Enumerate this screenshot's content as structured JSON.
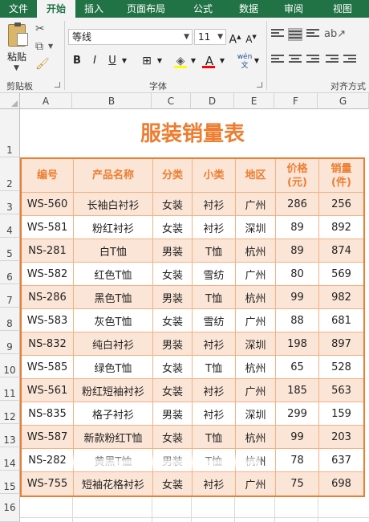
{
  "ribbon": {
    "tabs": [
      "文件",
      "开始",
      "插入",
      "页面布局",
      "公式",
      "数据",
      "审阅",
      "视图"
    ],
    "active_tab": "开始",
    "clipboard": {
      "paste_label": "粘贴",
      "group_label": "剪贴板"
    },
    "font": {
      "name": "等线",
      "size": "11",
      "bold": "B",
      "italic": "I",
      "underline": "U",
      "grow": "A",
      "shrink": "A",
      "group_label": "字体",
      "font_color": "A",
      "phonetic": "wén"
    },
    "alignment": {
      "group_label": "对齐方式"
    },
    "accent_color": "#217346"
  },
  "sheet": {
    "columns": [
      "A",
      "B",
      "C",
      "D",
      "E",
      "F",
      "G"
    ],
    "rows": [
      "1",
      "2",
      "3",
      "4",
      "5",
      "6",
      "7",
      "8",
      "9",
      "10",
      "11",
      "12",
      "13",
      "14",
      "15",
      "16"
    ],
    "title": "服装销量表",
    "headers": {
      "id": "编号",
      "name": "产品名称",
      "category": "分类",
      "subcategory": "小类",
      "region": "地区",
      "price_line1": "价格",
      "price_line2": "(元)",
      "sales_line1": "销量",
      "sales_line2": "(件)"
    },
    "data": [
      [
        "WS-560",
        "长袖白衬衫",
        "女装",
        "衬衫",
        "广州",
        "286",
        "256"
      ],
      [
        "WS-581",
        "粉红衬衫",
        "女装",
        "衬衫",
        "深圳",
        "89",
        "892"
      ],
      [
        "NS-281",
        "白T恤",
        "男装",
        "T恤",
        "杭州",
        "89",
        "874"
      ],
      [
        "WS-582",
        "红色T恤",
        "女装",
        "雪纺",
        "广州",
        "80",
        "569"
      ],
      [
        "NS-286",
        "黑色T恤",
        "男装",
        "T恤",
        "杭州",
        "99",
        "982"
      ],
      [
        "WS-583",
        "灰色T恤",
        "女装",
        "雪纺",
        "广州",
        "88",
        "681"
      ],
      [
        "NS-832",
        "纯白衬衫",
        "男装",
        "衬衫",
        "深圳",
        "198",
        "897"
      ],
      [
        "WS-585",
        "绿色T恤",
        "女装",
        "T恤",
        "杭州",
        "65",
        "528"
      ],
      [
        "WS-561",
        "粉红短袖衬衫",
        "女装",
        "衬衫",
        "广州",
        "185",
        "563"
      ],
      [
        "NS-835",
        "格子衬衫",
        "男装",
        "衬衫",
        "深圳",
        "299",
        "159"
      ],
      [
        "WS-587",
        "新款粉红T恤",
        "女装",
        "T恤",
        "杭州",
        "99",
        "203"
      ],
      [
        "NS-282",
        "黄黑T恤",
        "男装",
        "T恤",
        "杭州",
        "78",
        "637"
      ],
      [
        "WS-755",
        "短袖花格衬衫",
        "女装",
        "衬衫",
        "广州",
        "75",
        "698"
      ]
    ],
    "title_color": "#ed7d31",
    "band_color": "#fbe5d6",
    "border_color": "#f4b183"
  }
}
